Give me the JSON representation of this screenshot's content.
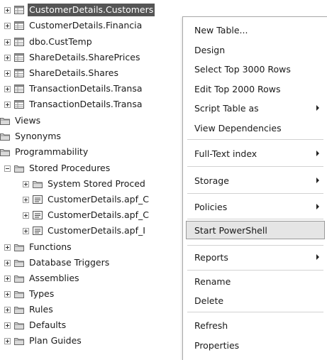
{
  "tree": {
    "items": [
      {
        "label": "CustomerDetails.Customers",
        "type": "table",
        "expander": "plus",
        "selected": true
      },
      {
        "label": "CustomerDetails.Financia",
        "type": "table",
        "expander": "plus"
      },
      {
        "label": "dbo.CustTemp",
        "type": "table",
        "expander": "plus"
      },
      {
        "label": "ShareDetails.SharePrices",
        "type": "table",
        "expander": "plus"
      },
      {
        "label": "ShareDetails.Shares",
        "type": "table",
        "expander": "plus"
      },
      {
        "label": "TransactionDetails.Transa",
        "type": "table",
        "expander": "plus"
      },
      {
        "label": "TransactionDetails.Transa",
        "type": "table",
        "expander": "plus"
      },
      {
        "label": "Views",
        "type": "folder",
        "expander": "none"
      },
      {
        "label": "Synonyms",
        "type": "folder",
        "expander": "none"
      },
      {
        "label": "Programmability",
        "type": "folder",
        "expander": "none"
      },
      {
        "label": "Stored Procedures",
        "type": "folder",
        "expander": "minus"
      },
      {
        "label": "System Stored Proced",
        "type": "folder",
        "expander": "plus"
      },
      {
        "label": "CustomerDetails.apf_C",
        "type": "procedure",
        "expander": "plus"
      },
      {
        "label": "CustomerDetails.apf_C",
        "type": "procedure",
        "expander": "plus"
      },
      {
        "label": "CustomerDetails.apf_I",
        "type": "procedure",
        "expander": "plus"
      },
      {
        "label": "Functions",
        "type": "folder",
        "expander": "plus"
      },
      {
        "label": "Database Triggers",
        "type": "folder",
        "expander": "plus"
      },
      {
        "label": "Assemblies",
        "type": "folder",
        "expander": "plus"
      },
      {
        "label": "Types",
        "type": "folder",
        "expander": "plus"
      },
      {
        "label": "Rules",
        "type": "folder",
        "expander": "plus"
      },
      {
        "label": "Defaults",
        "type": "folder",
        "expander": "plus"
      },
      {
        "label": "Plan Guides",
        "type": "folder",
        "expander": "plus"
      }
    ]
  },
  "context_menu": {
    "items": [
      {
        "label": "New Table...",
        "submenu": false
      },
      {
        "label": "Design",
        "submenu": false
      },
      {
        "label": "Select Top 3000 Rows",
        "submenu": false
      },
      {
        "label": "Edit Top 2000 Rows",
        "submenu": false
      },
      {
        "label": "Script Table as",
        "submenu": true
      },
      {
        "label": "View Dependencies",
        "submenu": false
      },
      {
        "separator": true
      },
      {
        "label": "Full-Text index",
        "submenu": true
      },
      {
        "separator": true
      },
      {
        "label": "Storage",
        "submenu": true
      },
      {
        "separator": true
      },
      {
        "label": "Policies",
        "submenu": true
      },
      {
        "separator": true
      },
      {
        "label": "Start PowerShell",
        "submenu": false,
        "highlighted": true
      },
      {
        "separator": true
      },
      {
        "label": "Reports",
        "submenu": true
      },
      {
        "separator": true
      },
      {
        "label": "Rename",
        "submenu": false
      },
      {
        "label": "Delete",
        "submenu": false
      },
      {
        "separator": true
      },
      {
        "label": "Refresh",
        "submenu": false
      },
      {
        "label": "Properties",
        "submenu": false
      }
    ]
  },
  "colors": {
    "selection": "#555555",
    "menu_highlight": "#e5e5e5",
    "folder": "#e8d79a"
  }
}
